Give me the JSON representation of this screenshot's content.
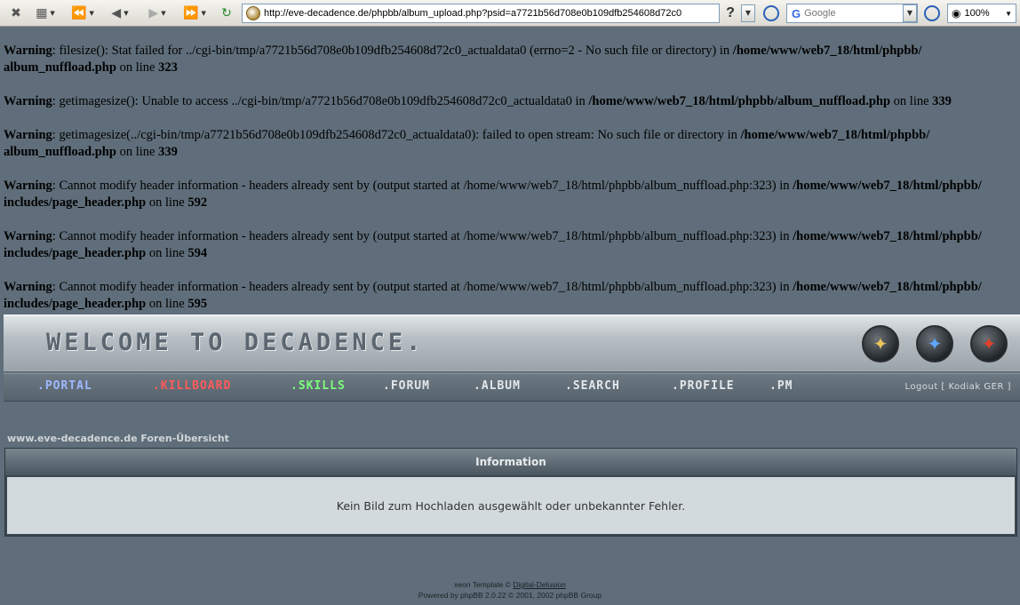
{
  "browser": {
    "url": "http://eve-decadence.de/phpbb/album_upload.php?psid=a7721b56d708e0b109dfb254608d72c0",
    "search_placeholder": "Google",
    "search_engine_letter": "G",
    "zoom": "100%",
    "help_label": "?"
  },
  "warnings": [
    {
      "label": "Warning",
      "text": ": filesize(): Stat failed for ../cgi-bin/tmp/a7721b56d708e0b109dfb254608d72c0_actualdata0 (errno=2 - No such file or directory) in ",
      "path": "/home/www/web7_18/html/phpbb/ album_nuffload.php",
      "suffix": " on line ",
      "line": "323"
    },
    {
      "label": "Warning",
      "text": ": getimagesize(): Unable to access ../cgi-bin/tmp/a7721b56d708e0b109dfb254608d72c0_actualdata0 in ",
      "path": "/home/www/web7_18/html/phpbb/album_nuffload.php",
      "suffix": " on line ",
      "line": "339"
    },
    {
      "label": "Warning",
      "text": ": getimagesize(../cgi-bin/tmp/a7721b56d708e0b109dfb254608d72c0_actualdata0): failed to open stream: No such file or directory in ",
      "path": "/home/www/web7_18/html/phpbb/ album_nuffload.php",
      "suffix": " on line ",
      "line": "339"
    },
    {
      "label": "Warning",
      "text": ": Cannot modify header information - headers already sent by (output started at /home/www/web7_18/html/phpbb/album_nuffload.php:323) in ",
      "path": "/home/www/web7_18/html/phpbb/ includes/page_header.php",
      "suffix": " on line ",
      "line": "592"
    },
    {
      "label": "Warning",
      "text": ": Cannot modify header information - headers already sent by (output started at /home/www/web7_18/html/phpbb/album_nuffload.php:323) in ",
      "path": "/home/www/web7_18/html/phpbb/ includes/page_header.php",
      "suffix": " on line ",
      "line": "594"
    },
    {
      "label": "Warning",
      "text": ": Cannot modify header information - headers already sent by (output started at /home/www/web7_18/html/phpbb/album_nuffload.php:323) in ",
      "path": "/home/www/web7_18/html/phpbb/ includes/page_header.php",
      "suffix": " on line ",
      "line": "595"
    }
  ],
  "banner": {
    "title": "WELCOME TO DECADENCE."
  },
  "nav": {
    "items": [
      {
        "label": ".PORTAL",
        "color": "#9fb8ff"
      },
      {
        "label": ".KILLBOARD",
        "color": "#ff5a5a"
      },
      {
        "label": ".SKILLS",
        "color": "#7dff7d"
      },
      {
        "label": ".FORUM",
        "color": "#e4e8ea"
      },
      {
        "label": ".ALBUM",
        "color": "#e4e8ea"
      },
      {
        "label": ".SEARCH",
        "color": "#e4e8ea"
      },
      {
        "label": ".PROFILE",
        "color": "#e4e8ea"
      },
      {
        "label": ".PM",
        "color": "#e4e8ea"
      }
    ],
    "logout": "Logout [ Kodiak GER ]"
  },
  "breadcrumb": "www.eve-decadence.de Foren-Übersicht",
  "info": {
    "title": "Information",
    "message": "Kein Bild zum Hochladen ausgewählt oder unbekannter Fehler."
  },
  "footer": {
    "line1_prefix": "xeon Template © ",
    "line1_link": "Digital-Delusion",
    "line2": "Powered by phpBB 2.0.22 © 2001, 2002 phpBB Group"
  },
  "colors": {
    "page_bg": "#5f6e7a",
    "emblem_gold": "#e8c45a",
    "emblem_blue": "#5fa8ff",
    "emblem_red": "#e0402a"
  }
}
